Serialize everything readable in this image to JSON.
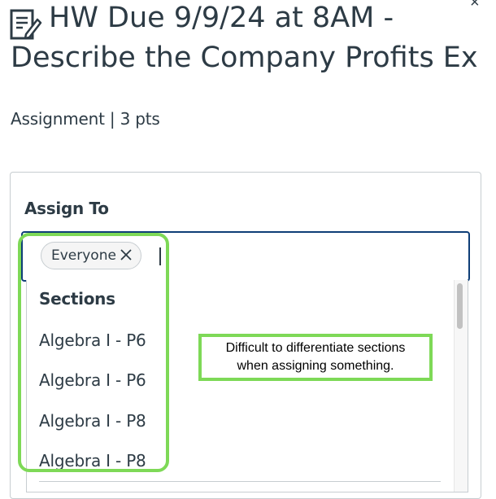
{
  "header": {
    "title_line1": "HW Due 9/9/24 at 8AM -",
    "title_line2": "Describe the Company Profits Ex",
    "close_glyph": "×"
  },
  "meta": {
    "text": "Assignment | 3 pts"
  },
  "assign": {
    "label": "Assign To",
    "chip_label": "Everyone",
    "dropdown": {
      "group_label": "Sections",
      "options": [
        "Algebra I - P6",
        "Algebra I - P6",
        "Algebra I - P8",
        "Algebra I - P8"
      ]
    }
  },
  "annotation": {
    "line1": "Difficult to differentiate sections",
    "line2": "when assigning something.",
    "color": "#7ed957"
  },
  "icons": {
    "title_icon": "assignment-edit-icon",
    "chip_remove": "close-icon"
  }
}
